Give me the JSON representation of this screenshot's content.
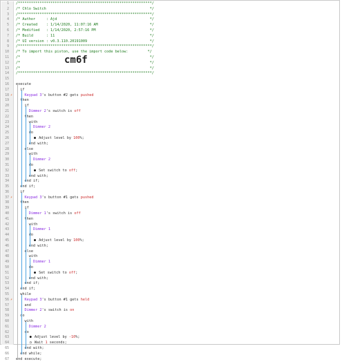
{
  "lines": [
    {
      "n": "1",
      "segs": [
        {
          "t": "/**************************************************************/",
          "c": "comment"
        }
      ]
    },
    {
      "n": "2",
      "segs": [
        {
          "t": "/* Chlo Switch                                                */",
          "c": "comment"
        }
      ]
    },
    {
      "n": "3",
      "segs": [
        {
          "t": "/**************************************************************/",
          "c": "comment"
        }
      ]
    },
    {
      "n": "4",
      "segs": [
        {
          "t": "/* Author     : Ajd                                           */",
          "c": "comment"
        }
      ]
    },
    {
      "n": "5",
      "segs": [
        {
          "t": "/* Created    : 1/14/2020, 11:07:16 AM                        */",
          "c": "comment"
        }
      ]
    },
    {
      "n": "6",
      "segs": [
        {
          "t": "/* Modified   : 1/14/2020, 2:57:16 PM                         */",
          "c": "comment"
        }
      ]
    },
    {
      "n": "7",
      "segs": [
        {
          "t": "/* Build      : 11                                            */",
          "c": "comment"
        }
      ]
    },
    {
      "n": "8",
      "segs": [
        {
          "t": "/* UI version : v0.3.110.20191009                             */",
          "c": "comment"
        }
      ]
    },
    {
      "n": "9",
      "segs": [
        {
          "t": "/**************************************************************/",
          "c": "comment"
        }
      ]
    },
    {
      "n": "10",
      "segs": [
        {
          "t": "/* To import this piston, use the import code below:         */",
          "c": "comment"
        }
      ]
    },
    {
      "n": "11",
      "segs": [
        {
          "t": "/*                                                            */",
          "c": "comment"
        }
      ]
    },
    {
      "n": "12",
      "big": "cm6f",
      "segs": [
        {
          "t": "/*                                                            */",
          "c": "comment"
        }
      ]
    },
    {
      "n": "13",
      "segs": [
        {
          "t": "/*                                                            */",
          "c": "comment"
        }
      ]
    },
    {
      "n": "14",
      "segs": [
        {
          "t": "/**************************************************************/",
          "c": "comment"
        }
      ]
    },
    {
      "n": "15",
      "segs": []
    },
    {
      "n": "16",
      "segs": [
        {
          "t": "execute",
          "c": "kw"
        }
      ]
    },
    {
      "n": "17",
      "segs": [
        {
          "t": "  if",
          "c": "kw"
        }
      ]
    },
    {
      "n": "18",
      "mark": "⚡",
      "segs": [
        {
          "t": "    Keypad 3",
          "c": "dev"
        },
        {
          "t": "'s button #2 gets ",
          "c": "kw"
        },
        {
          "t": "pushed",
          "c": "str"
        }
      ]
    },
    {
      "n": "19",
      "segs": [
        {
          "t": "  then",
          "c": "kw"
        }
      ]
    },
    {
      "n": "20",
      "segs": [
        {
          "t": "    if",
          "c": "kw"
        }
      ]
    },
    {
      "n": "21",
      "segs": [
        {
          "t": "      Dimmer 2",
          "c": "dev"
        },
        {
          "t": "'s switch is ",
          "c": "kw"
        },
        {
          "t": "off",
          "c": "str"
        }
      ]
    },
    {
      "n": "22",
      "segs": [
        {
          "t": "    then",
          "c": "kw"
        }
      ]
    },
    {
      "n": "23",
      "segs": [
        {
          "t": "      with",
          "c": "kw"
        }
      ]
    },
    {
      "n": "24",
      "segs": [
        {
          "t": "        Dimmer 2",
          "c": "dev"
        }
      ]
    },
    {
      "n": "25",
      "segs": [
        {
          "t": "      do",
          "c": "kw"
        }
      ]
    },
    {
      "n": "26",
      "icon": "●",
      "segs": [
        {
          "t": "          Adjust level by ",
          "c": "kw"
        },
        {
          "t": "100",
          "c": "num"
        },
        {
          "t": "%;",
          "c": "kw"
        }
      ]
    },
    {
      "n": "27",
      "segs": [
        {
          "t": "      end with;",
          "c": "kw"
        }
      ]
    },
    {
      "n": "28",
      "segs": [
        {
          "t": "    else",
          "c": "kw"
        }
      ]
    },
    {
      "n": "29",
      "segs": [
        {
          "t": "      with",
          "c": "kw"
        }
      ]
    },
    {
      "n": "30",
      "segs": [
        {
          "t": "        Dimmer 2",
          "c": "dev"
        }
      ]
    },
    {
      "n": "31",
      "segs": [
        {
          "t": "      do",
          "c": "kw"
        }
      ]
    },
    {
      "n": "32",
      "icon": "●",
      "segs": [
        {
          "t": "          Set switch to ",
          "c": "kw"
        },
        {
          "t": "off",
          "c": "str"
        },
        {
          "t": ";",
          "c": "kw"
        }
      ]
    },
    {
      "n": "33",
      "segs": [
        {
          "t": "      end with;",
          "c": "kw"
        }
      ]
    },
    {
      "n": "34",
      "segs": [
        {
          "t": "    end if;",
          "c": "kw"
        }
      ]
    },
    {
      "n": "35",
      "segs": [
        {
          "t": "  end if;",
          "c": "kw"
        }
      ]
    },
    {
      "n": "36",
      "segs": [
        {
          "t": "  if",
          "c": "kw"
        }
      ]
    },
    {
      "n": "37",
      "mark": "⚡",
      "segs": [
        {
          "t": "    Keypad 3",
          "c": "dev"
        },
        {
          "t": "'s button #1 gets ",
          "c": "kw"
        },
        {
          "t": "pushed",
          "c": "str"
        }
      ]
    },
    {
      "n": "38",
      "segs": [
        {
          "t": "  then",
          "c": "kw"
        }
      ]
    },
    {
      "n": "39",
      "segs": [
        {
          "t": "    if",
          "c": "kw"
        }
      ]
    },
    {
      "n": "40",
      "segs": [
        {
          "t": "      Dimmer 1",
          "c": "dev"
        },
        {
          "t": "'s switch is ",
          "c": "kw"
        },
        {
          "t": "off",
          "c": "str"
        }
      ]
    },
    {
      "n": "41",
      "segs": [
        {
          "t": "    then",
          "c": "kw"
        }
      ]
    },
    {
      "n": "42",
      "segs": [
        {
          "t": "      with",
          "c": "kw"
        }
      ]
    },
    {
      "n": "43",
      "segs": [
        {
          "t": "        Dimmer 1",
          "c": "dev"
        }
      ]
    },
    {
      "n": "44",
      "segs": [
        {
          "t": "      do",
          "c": "kw"
        }
      ]
    },
    {
      "n": "45",
      "icon": "●",
      "segs": [
        {
          "t": "          Adjust level by ",
          "c": "kw"
        },
        {
          "t": "100",
          "c": "num"
        },
        {
          "t": "%;",
          "c": "kw"
        }
      ]
    },
    {
      "n": "46",
      "segs": [
        {
          "t": "      end with;",
          "c": "kw"
        }
      ]
    },
    {
      "n": "47",
      "segs": [
        {
          "t": "    else",
          "c": "kw"
        }
      ]
    },
    {
      "n": "48",
      "segs": [
        {
          "t": "      with",
          "c": "kw"
        }
      ]
    },
    {
      "n": "49",
      "segs": [
        {
          "t": "        Dimmer 1",
          "c": "dev"
        }
      ]
    },
    {
      "n": "50",
      "segs": [
        {
          "t": "      do",
          "c": "kw"
        }
      ]
    },
    {
      "n": "51",
      "icon": "●",
      "segs": [
        {
          "t": "          Set switch to ",
          "c": "kw"
        },
        {
          "t": "off",
          "c": "str"
        },
        {
          "t": ";",
          "c": "kw"
        }
      ]
    },
    {
      "n": "52",
      "segs": [
        {
          "t": "      end with;",
          "c": "kw"
        }
      ]
    },
    {
      "n": "53",
      "segs": [
        {
          "t": "    end if;",
          "c": "kw"
        }
      ]
    },
    {
      "n": "54",
      "segs": [
        {
          "t": "  end if;",
          "c": "kw"
        }
      ]
    },
    {
      "n": "55",
      "segs": [
        {
          "t": "  while",
          "c": "kw"
        }
      ]
    },
    {
      "n": "56",
      "mark": "⚡",
      "segs": [
        {
          "t": "    Keypad 3",
          "c": "dev"
        },
        {
          "t": "'s button #1 gets ",
          "c": "kw"
        },
        {
          "t": "held",
          "c": "str"
        }
      ]
    },
    {
      "n": "57",
      "segs": [
        {
          "t": "    and",
          "c": "kw"
        }
      ]
    },
    {
      "n": "58",
      "segs": [
        {
          "t": "    Dimmer 2",
          "c": "dev"
        },
        {
          "t": "'s switch is ",
          "c": "kw"
        },
        {
          "t": "on",
          "c": "str"
        }
      ]
    },
    {
      "n": "59",
      "segs": [
        {
          "t": "  do",
          "c": "kw"
        }
      ]
    },
    {
      "n": "60",
      "segs": [
        {
          "t": "    with",
          "c": "kw"
        }
      ]
    },
    {
      "n": "61",
      "segs": [
        {
          "t": "      Dimmer 2",
          "c": "dev"
        }
      ]
    },
    {
      "n": "62",
      "segs": [
        {
          "t": "    do",
          "c": "kw"
        }
      ]
    },
    {
      "n": "63",
      "icon": "●",
      "segs": [
        {
          "t": "        Adjust level by ",
          "c": "kw"
        },
        {
          "t": "-10",
          "c": "num"
        },
        {
          "t": "%;",
          "c": "kw"
        }
      ]
    },
    {
      "n": "64",
      "icon": "◷",
      "segs": [
        {
          "t": "        Wait ",
          "c": "kw"
        },
        {
          "t": "1",
          "c": "num"
        },
        {
          "t": " seconds;",
          "c": "kw"
        }
      ]
    },
    {
      "n": "65",
      "segs": [
        {
          "t": "    end with;",
          "c": "kw"
        }
      ]
    },
    {
      "n": "66",
      "segs": [
        {
          "t": "  end while;",
          "c": "kw"
        }
      ]
    },
    {
      "n": "67",
      "segs": [
        {
          "t": "end execute;",
          "c": "kw"
        }
      ]
    }
  ]
}
